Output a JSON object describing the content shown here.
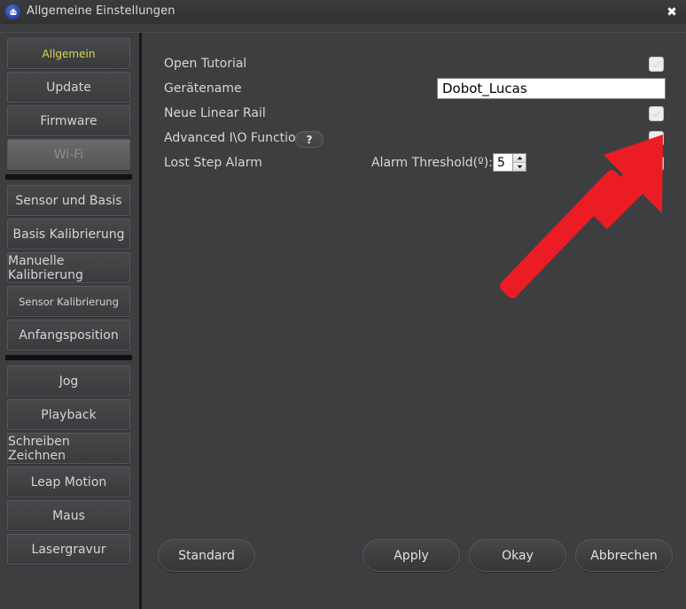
{
  "window": {
    "title": "Allgemeine Einstellungen",
    "app_icon": "dobot-robot-icon",
    "close_label": "✖"
  },
  "sidebar": {
    "groups": [
      {
        "items": [
          {
            "label": "Allgemein",
            "state": "active"
          },
          {
            "label": "Update",
            "state": "normal"
          },
          {
            "label": "Firmware",
            "state": "normal"
          },
          {
            "label": "Wi-Fi",
            "state": "selected"
          }
        ]
      },
      {
        "items": [
          {
            "label": "Sensor und Basis",
            "state": "normal"
          },
          {
            "label": "Basis Kalibrierung",
            "state": "normal"
          },
          {
            "label": "Manuelle Kalibrierung",
            "state": "normal"
          },
          {
            "label": "Sensor Kalibrierung",
            "state": "small"
          },
          {
            "label": "Anfangsposition",
            "state": "normal"
          }
        ]
      },
      {
        "items": [
          {
            "label": "Jog",
            "state": "normal"
          },
          {
            "label": "Playback",
            "state": "normal"
          },
          {
            "label": "Schreiben  Zeichnen",
            "state": "normal"
          },
          {
            "label": "Leap Motion",
            "state": "normal"
          },
          {
            "label": "Maus",
            "state": "normal"
          },
          {
            "label": "Lasergravur",
            "state": "normal"
          }
        ]
      }
    ]
  },
  "main": {
    "rows": {
      "open_tutorial": {
        "label": "Open Tutorial",
        "checked": false
      },
      "device_name": {
        "label": "Gerätename",
        "value": "Dobot_Lucas",
        "placeholder": ""
      },
      "new_linear_rail": {
        "label": "Neue Linear Rail",
        "checked": false
      },
      "advanced_io": {
        "label": "Advanced I\\O Function",
        "help": "?",
        "checked": true
      },
      "lost_step_alarm": {
        "label": "Lost Step Alarm",
        "checked": false,
        "threshold_label": "Alarm Threshold(º):",
        "threshold_value": "5"
      }
    }
  },
  "footer": {
    "standard": "Standard",
    "apply": "Apply",
    "okay": "Okay",
    "cancel": "Abbrechen"
  },
  "annotation": {
    "type": "red-arrow",
    "color": "#ec1c24",
    "points_to": "advanced-io-checkbox"
  },
  "colors": {
    "background": "#3d3e40",
    "titlebar": "#343537",
    "active_item_text": "#d7d84a",
    "checkmark_green": "#4caf17",
    "annotation_red": "#ec1c24",
    "input_background": "#ffffff"
  }
}
